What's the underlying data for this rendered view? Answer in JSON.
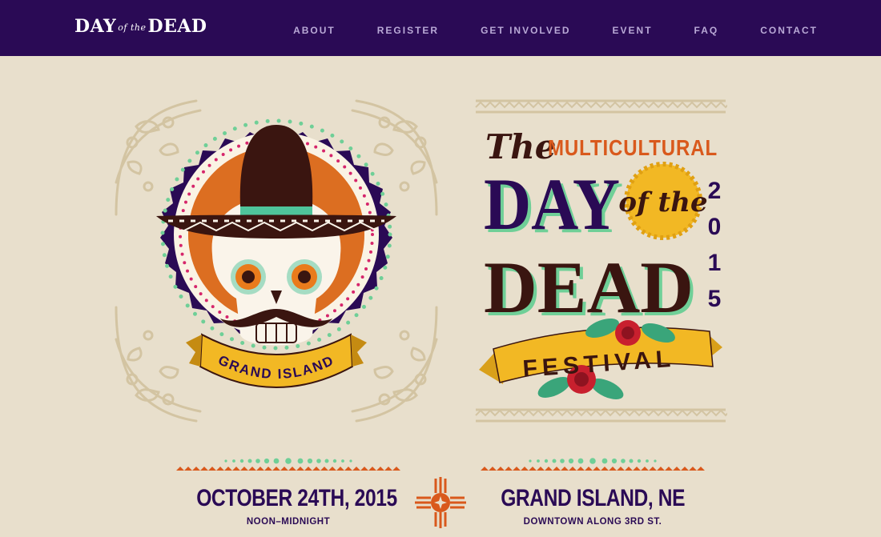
{
  "header": {
    "logo": {
      "day": "DAY",
      "of_the": "of the",
      "dead": "DEAD"
    },
    "nav": [
      "ABOUT",
      "REGISTER",
      "GET INVOLVED",
      "EVENT",
      "FAQ",
      "CONTACT"
    ]
  },
  "left_art": {
    "banner": "GRAND ISLAND"
  },
  "right_art": {
    "the": "The",
    "multicultural": "MULTICULTURAL",
    "day": "DAY",
    "of_the": "of the",
    "dead": "DEAD",
    "year_digits": [
      "2",
      "0",
      "1",
      "5"
    ],
    "festival": "FESTIVAL"
  },
  "info": {
    "date": {
      "headline": "OCTOBER 24TH, 2015",
      "sub": "NOON–MIDNIGHT"
    },
    "location": {
      "headline": "GRAND ISLAND, NE",
      "sub": "DOWNTOWN ALONG 3RD ST."
    }
  },
  "colors": {
    "navy": "#2a0a55",
    "background": "#e8dfcc",
    "orange": "#d9591c",
    "gold": "#f2b824",
    "mint": "#6fcf97",
    "red": "#c8202e",
    "brown": "#3a1510"
  },
  "icons": [
    "zia-sun-icon",
    "sugar-skull-illustration",
    "sombrero-icon",
    "flower-ornament-icon",
    "rose-icon"
  ]
}
